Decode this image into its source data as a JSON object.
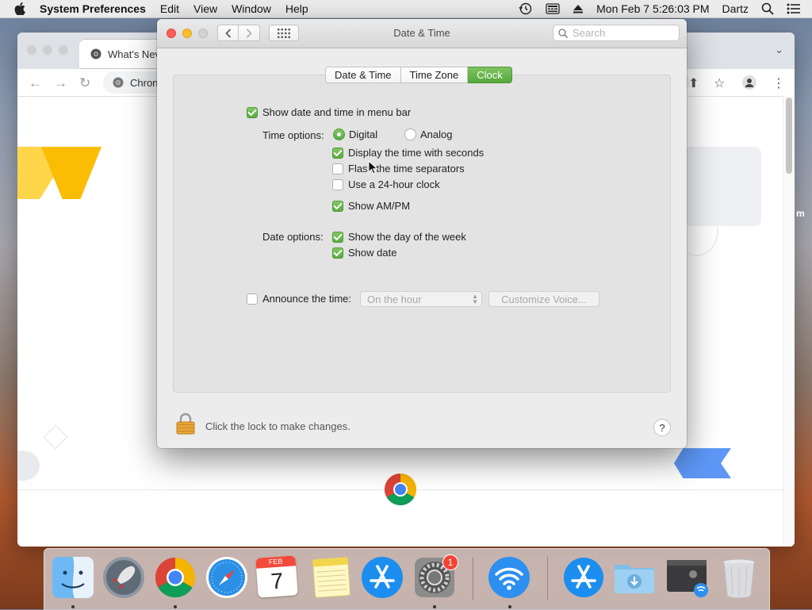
{
  "menubar": {
    "app_name": "System Preferences",
    "items": [
      "Edit",
      "View",
      "Window",
      "Help"
    ],
    "datetime": "Mon Feb 7  5:26:03 PM",
    "user": "Dartz"
  },
  "chrome": {
    "tab_title": "What's Nev",
    "omnibox_text": "Chron",
    "side_text": "m"
  },
  "prefs": {
    "window_title": "Date & Time",
    "search_placeholder": "Search",
    "tabs": [
      {
        "label": "Date & Time",
        "active": false
      },
      {
        "label": "Time Zone",
        "active": false
      },
      {
        "label": "Clock",
        "active": true
      }
    ],
    "show_in_menubar": {
      "label": "Show date and time in menu bar",
      "checked": true
    },
    "time_options_label": "Time options:",
    "radio_digital": {
      "label": "Digital",
      "selected": true
    },
    "radio_analog": {
      "label": "Analog",
      "selected": false
    },
    "time_checks": [
      {
        "label": "Display the time with seconds",
        "checked": true
      },
      {
        "label": "Flash the time separators",
        "checked": false
      },
      {
        "label": "Use a 24-hour clock",
        "checked": false
      },
      {
        "label": "Show AM/PM",
        "checked": true
      }
    ],
    "date_options_label": "Date options:",
    "date_checks": [
      {
        "label": "Show the day of the week",
        "checked": true
      },
      {
        "label": "Show date",
        "checked": true
      }
    ],
    "announce": {
      "label": "Announce the time:",
      "checked": false
    },
    "announce_interval": "On the hour",
    "customize_voice": "Customize Voice...",
    "lock_text": "Click the lock to make changes.",
    "help_label": "?"
  },
  "dock": {
    "calendar_month": "FEB",
    "calendar_day": "7",
    "sysprefs_badge": "1"
  },
  "colors": {
    "accent_green": "#59ab41",
    "close_red": "#ff5f57",
    "minimize_yellow": "#ffbd2e"
  }
}
